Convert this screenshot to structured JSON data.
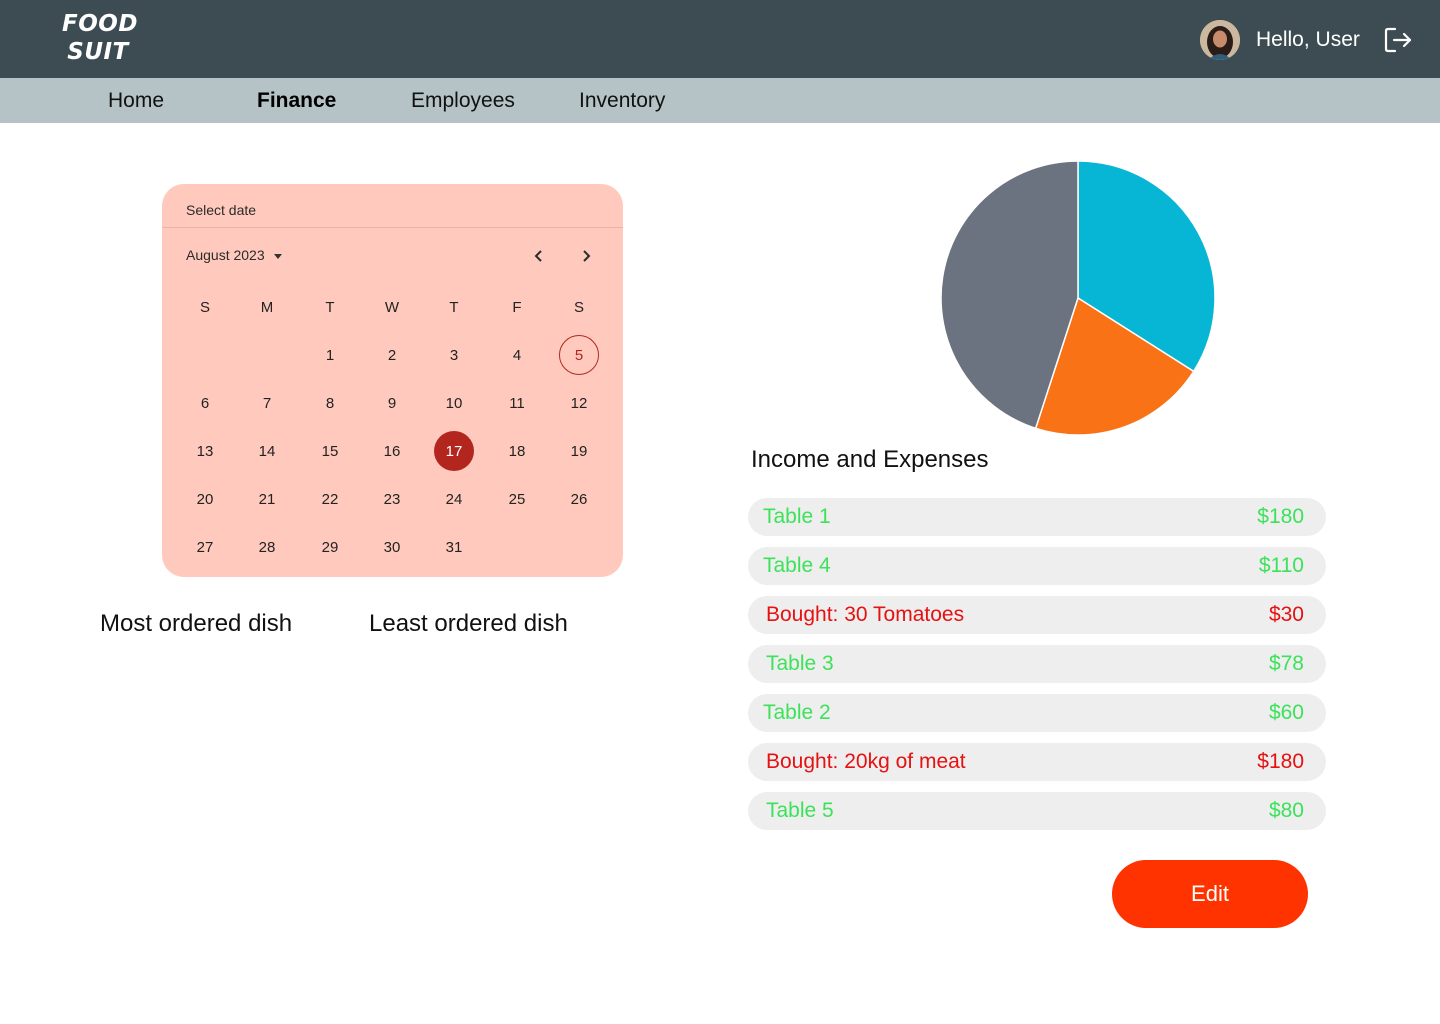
{
  "app": {
    "logo_line1": "FOOD",
    "logo_line2": "SUIT",
    "greeting": "Hello, User"
  },
  "nav": {
    "items": [
      "Home",
      "Finance",
      "Employees",
      "Inventory"
    ],
    "active": "Finance"
  },
  "calendar": {
    "header": "Select date",
    "month_label": "August 2023",
    "weekdays": [
      "S",
      "M",
      "T",
      "W",
      "T",
      "F",
      "S"
    ],
    "days": [
      "1",
      "2",
      "3",
      "4",
      "5",
      "6",
      "7",
      "8",
      "9",
      "10",
      "11",
      "12",
      "13",
      "14",
      "15",
      "16",
      "17",
      "18",
      "19",
      "20",
      "21",
      "22",
      "23",
      "24",
      "25",
      "26",
      "27",
      "28",
      "29",
      "30",
      "31"
    ],
    "today": "5",
    "selected": "17"
  },
  "labels": {
    "most_ordered": "Most ordered dish",
    "least_ordered": "Least ordered dish",
    "income_expenses": "Income and Expenses"
  },
  "chart_data": {
    "type": "pie",
    "slices": [
      {
        "value": 34,
        "color": "#06b6d4"
      },
      {
        "value": 21,
        "color": "#f97316"
      },
      {
        "value": 45,
        "color": "#6b7280"
      }
    ]
  },
  "transactions": [
    {
      "label": "Table 1",
      "amount": "$180",
      "kind": "income"
    },
    {
      "label": "Table 4",
      "amount": "$110",
      "kind": "income"
    },
    {
      "label": "Bought: 30 Tomatoes",
      "amount": "$30",
      "kind": "expense"
    },
    {
      "label": "Table 3",
      "amount": "$78",
      "kind": "income"
    },
    {
      "label": "Table 2",
      "amount": "$60",
      "kind": "income"
    },
    {
      "label": "Bought: 20kg of meat",
      "amount": "$180",
      "kind": "expense"
    },
    {
      "label": "Table 5",
      "amount": "$80",
      "kind": "income"
    }
  ],
  "edit_label": "Edit",
  "colors": {
    "header": "#3d4c53",
    "nav": "#b5c3c7",
    "calendar_bg": "#ffcabd",
    "accent": "#b3261e",
    "income": "#3ce25a",
    "expense": "#e61111",
    "edit_button": "#ff3300"
  },
  "icons": {
    "logout": "logout-icon",
    "prev": "chevron-left-icon",
    "next": "chevron-right-icon",
    "dropdown": "caret-down-icon"
  }
}
